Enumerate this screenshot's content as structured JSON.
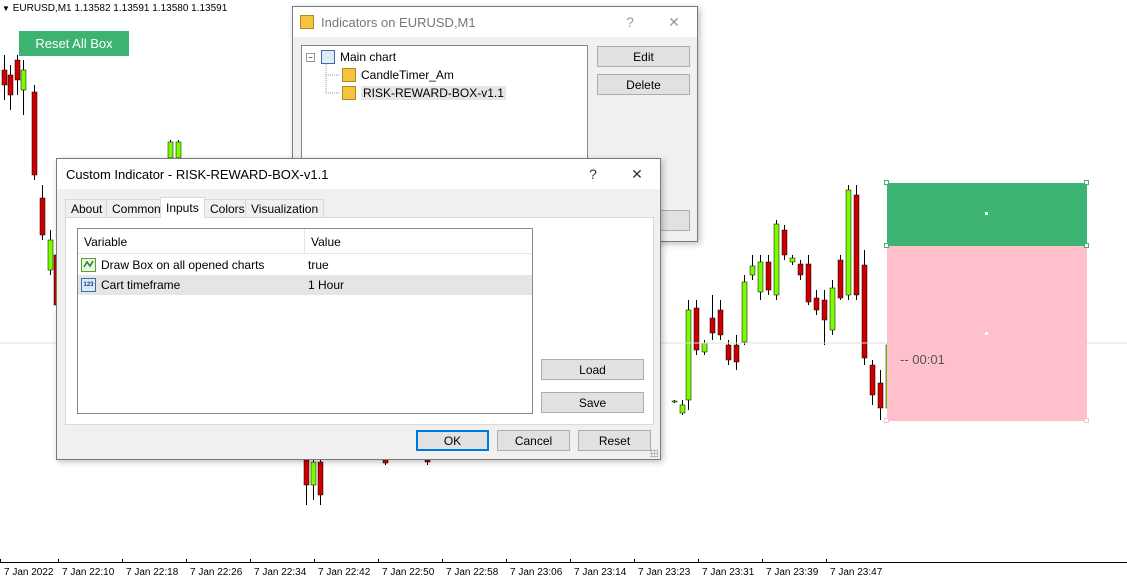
{
  "chart": {
    "symbol_line": "EURUSD,M1  1.13582 1.13591 1.13580 1.13591",
    "reset_button": "Reset All Box",
    "timer_text": "--  00:01",
    "time_labels": [
      "7 Jan 2022",
      "7 Jan 22:10",
      "7 Jan 22:18",
      "7 Jan 22:26",
      "7 Jan 22:34",
      "7 Jan 22:42",
      "7 Jan 22:50",
      "7 Jan 22:58",
      "7 Jan 23:06",
      "7 Jan 23:14",
      "7 Jan 23:23",
      "7 Jan 23:31",
      "7 Jan 23:39",
      "7 Jan 23:47"
    ],
    "colors": {
      "bull": "#7cfc00",
      "bear": "#cc0000",
      "box_reward": "#3cb371",
      "box_risk": "#ffc0cb"
    }
  },
  "indicators_window": {
    "title": "Indicators on EURUSD,M1",
    "help": "?",
    "close": "✕",
    "tree": {
      "root": "Main chart",
      "items": [
        "CandleTimer_Am",
        "RISK-REWARD-BOX-v1.1"
      ]
    },
    "edit_button": "Edit",
    "delete_button": "Delete"
  },
  "custom_indicator_dialog": {
    "title": "Custom Indicator - RISK-REWARD-BOX-v1.1",
    "help": "?",
    "close": "✕",
    "tabs": [
      "About",
      "Common",
      "Inputs",
      "Colors",
      "Visualization"
    ],
    "active_tab": "Inputs",
    "grid": {
      "headers": [
        "Variable",
        "Value"
      ],
      "rows": [
        {
          "icon": "boolean-icon",
          "variable": "Draw Box on all opened charts",
          "value": "true"
        },
        {
          "icon": "enum-123-icon",
          "variable": "Cart timeframe",
          "value": "1 Hour"
        }
      ]
    },
    "load_button": "Load",
    "save_button": "Save",
    "ok_button": "OK",
    "cancel_button": "Cancel",
    "reset_button": "Reset"
  }
}
